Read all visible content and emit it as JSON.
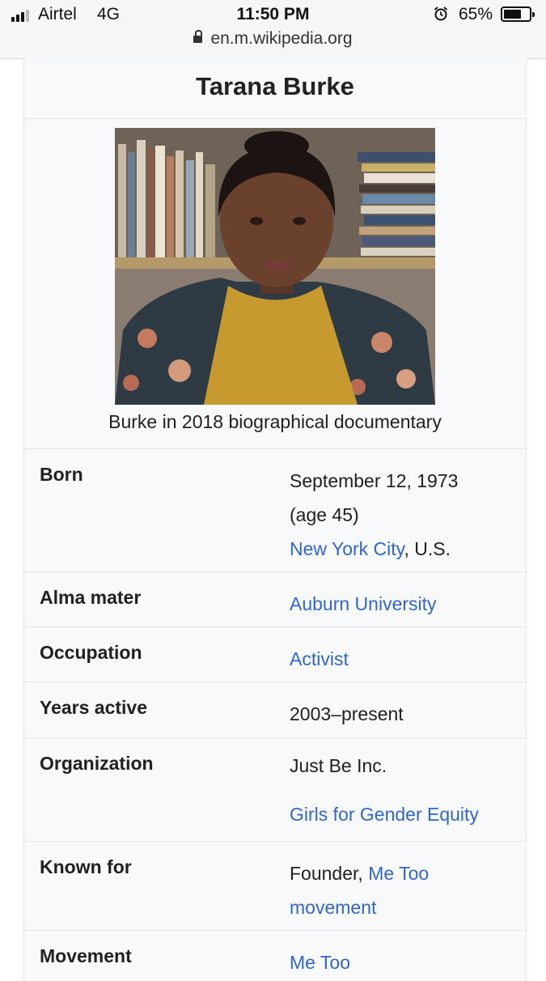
{
  "status_bar": {
    "carrier": "Airtel",
    "network": "4G",
    "time": "11:50 PM",
    "battery_percent": "65%",
    "battery_level": 0.65,
    "icons": [
      "signal-icon",
      "alarm-icon",
      "battery-icon",
      "lock-icon"
    ],
    "url": "en.m.wikipedia.org"
  },
  "infobox": {
    "title": "Tarana Burke",
    "image_caption": "Burke in 2018 biographical documentary",
    "rows": {
      "born": {
        "label": "Born",
        "date": "September 12, 1973",
        "age": "(age 45)",
        "place_link": "New York City",
        "place_suffix": ", U.S."
      },
      "alma_mater": {
        "label": "Alma mater",
        "link": "Auburn University"
      },
      "occupation": {
        "label": "Occupation",
        "link": "Activist"
      },
      "years_active": {
        "label": "Years active",
        "value": "2003–present"
      },
      "organization": {
        "label": "Organization",
        "value": "Just Be Inc.",
        "link": "Girls for Gender Equity"
      },
      "known_for": {
        "label": "Known for",
        "prefix": "Founder, ",
        "link_line1": "Me Too",
        "link_line2": "movement"
      },
      "movement": {
        "label": "Movement",
        "link": "Me Too"
      }
    }
  },
  "colors": {
    "link": "#3366cc",
    "infobox_bg": "#f8f9fa",
    "border": "#e2e4e8",
    "text": "#202122"
  }
}
